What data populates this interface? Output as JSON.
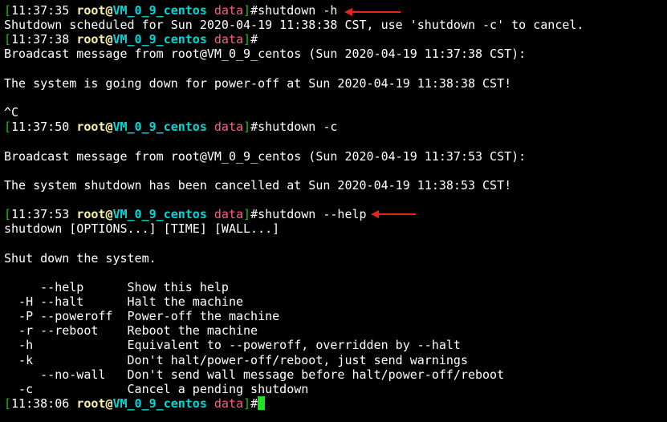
{
  "colors": {
    "background": "#000000",
    "bracket": "#16c60c",
    "user": "#f9f1a5",
    "host": "#00d7d7",
    "dir": "#ff5f87",
    "text": "#ffffff",
    "cursor": "#19e619",
    "annotation_arrow": "#e8231c"
  },
  "prompt": {
    "open": "[",
    "user": "root",
    "at": "@",
    "host": "VM_0_9_centos",
    "dir": "data",
    "close": "]",
    "hash": "#"
  },
  "lines": [
    {
      "kind": "prompt",
      "time": "11:37:35",
      "cmd": "shutdown -h"
    },
    {
      "kind": "out",
      "text": "Shutdown scheduled for Sun 2020-04-19 11:38:38 CST, use 'shutdown -c' to cancel."
    },
    {
      "kind": "prompt",
      "time": "11:37:38",
      "cmd": ""
    },
    {
      "kind": "out",
      "text": "Broadcast message from root@VM_0_9_centos (Sun 2020-04-19 11:37:38 CST):"
    },
    {
      "kind": "out",
      "text": ""
    },
    {
      "kind": "out",
      "text": "The system is going down for power-off at Sun 2020-04-19 11:38:38 CST!"
    },
    {
      "kind": "out",
      "text": ""
    },
    {
      "kind": "out",
      "text": "^C"
    },
    {
      "kind": "prompt",
      "time": "11:37:50",
      "cmd": "shutdown -c"
    },
    {
      "kind": "out",
      "text": ""
    },
    {
      "kind": "out",
      "text": "Broadcast message from root@VM_0_9_centos (Sun 2020-04-19 11:37:53 CST):"
    },
    {
      "kind": "out",
      "text": ""
    },
    {
      "kind": "out",
      "text": "The system shutdown has been cancelled at Sun 2020-04-19 11:38:53 CST!"
    },
    {
      "kind": "out",
      "text": ""
    },
    {
      "kind": "prompt",
      "time": "11:37:53",
      "cmd": "shutdown --help"
    },
    {
      "kind": "out",
      "text": "shutdown [OPTIONS...] [TIME] [WALL...]"
    },
    {
      "kind": "out",
      "text": ""
    },
    {
      "kind": "out",
      "text": "Shut down the system."
    },
    {
      "kind": "out",
      "text": ""
    },
    {
      "kind": "out",
      "text": "     --help      Show this help"
    },
    {
      "kind": "out",
      "text": "  -H --halt      Halt the machine"
    },
    {
      "kind": "out",
      "text": "  -P --poweroff  Power-off the machine"
    },
    {
      "kind": "out",
      "text": "  -r --reboot    Reboot the machine"
    },
    {
      "kind": "out",
      "text": "  -h             Equivalent to --poweroff, overridden by --halt"
    },
    {
      "kind": "out",
      "text": "  -k             Don't halt/power-off/reboot, just send warnings"
    },
    {
      "kind": "out",
      "text": "     --no-wall   Don't send wall message before halt/power-off/reboot"
    },
    {
      "kind": "out",
      "text": "  -c             Cancel a pending shutdown"
    },
    {
      "kind": "prompt",
      "time": "11:38:06",
      "cmd": "",
      "cursor": true
    }
  ]
}
